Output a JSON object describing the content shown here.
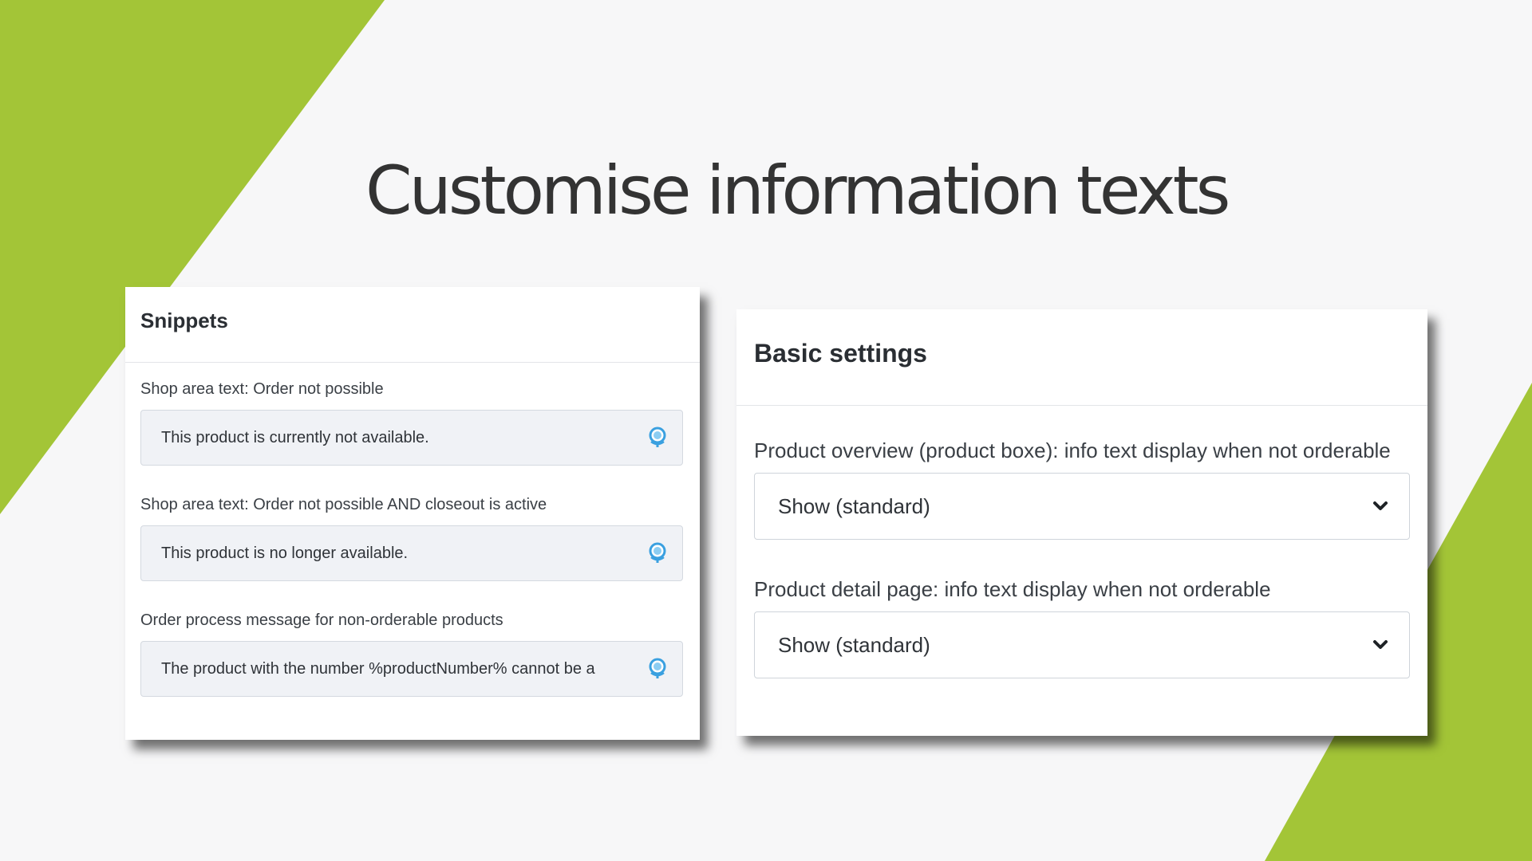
{
  "slide": {
    "title": "Customise information texts",
    "colors": {
      "accent": "#a3c537",
      "background": "#f7f7f8"
    }
  },
  "snippets_panel": {
    "title": "Snippets",
    "fields": [
      {
        "label": "Shop area text: Order not possible",
        "value": "This product is currently not available.",
        "icon": "globe-icon"
      },
      {
        "label": "Shop area text: Order not possible AND closeout is active",
        "value": "This product is no longer available.",
        "icon": "globe-icon"
      },
      {
        "label": "Order process message for non-orderable products",
        "value": "The product with the number %productNumber% cannot be a",
        "icon": "globe-icon"
      }
    ]
  },
  "settings_panel": {
    "title": "Basic settings",
    "fields": [
      {
        "label": "Product overview (product boxe): info text display when not orderable",
        "selected": "Show (standard)",
        "icon": "chevron-down-icon"
      },
      {
        "label": "Product detail page: info text display when not orderable",
        "selected": "Show (standard)",
        "icon": "chevron-down-icon"
      }
    ]
  }
}
